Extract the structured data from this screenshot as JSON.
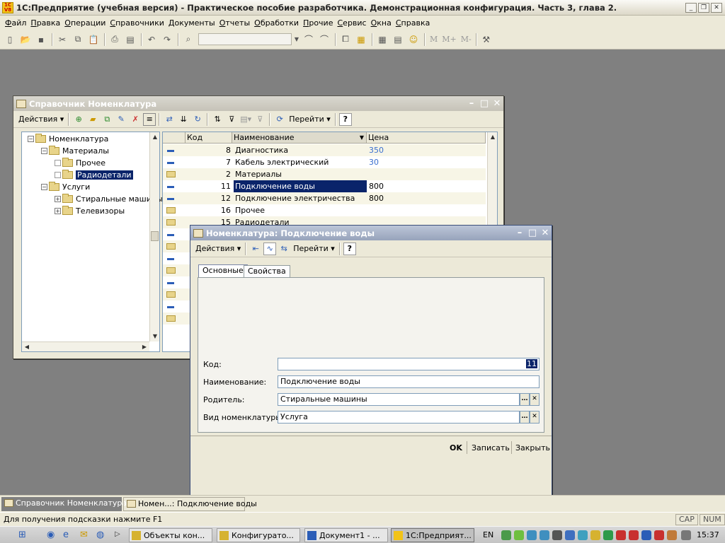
{
  "app": {
    "title": "1С:Предприятие (учебная версия) - Практическое пособие разработчика. Демонстрационная конфигурация. Часть 3, глава 2."
  },
  "menu": [
    {
      "pre": "",
      "u": "Ф",
      "post": "айл"
    },
    {
      "pre": "",
      "u": "П",
      "post": "равка"
    },
    {
      "pre": "",
      "u": "О",
      "post": "перации"
    },
    {
      "pre": "",
      "u": "С",
      "post": "правочники"
    },
    {
      "pre": "",
      "u": "Д",
      "post": "окументы"
    },
    {
      "pre": "",
      "u": "О",
      "post": "тчеты"
    },
    {
      "pre": "",
      "u": "О",
      "post": "бработки"
    },
    {
      "pre": "",
      "u": "П",
      "post": "рочие"
    },
    {
      "pre": "",
      "u": "С",
      "post": "ервис"
    },
    {
      "pre": "",
      "u": "О",
      "post": "кна"
    },
    {
      "pre": "",
      "u": "С",
      "post": "правка"
    }
  ],
  "toolbar_m": [
    "M",
    "M+",
    "M-"
  ],
  "catalog_window": {
    "title": "Справочник Номенклатура",
    "actions_label": "Действия",
    "goto_label": "Перейти",
    "help_label": "?",
    "tree": [
      {
        "label": "Номенклатура",
        "level": 0,
        "box": "-"
      },
      {
        "label": "Материалы",
        "level": 1,
        "box": "-"
      },
      {
        "label": "Прочее",
        "level": 2,
        "box": ""
      },
      {
        "label": "Радиодетали",
        "level": 2,
        "box": "",
        "selected": true
      },
      {
        "label": "Услуги",
        "level": 1,
        "box": "-"
      },
      {
        "label": "Стиральные машины",
        "level": 2,
        "box": "+"
      },
      {
        "label": "Телевизоры",
        "level": 2,
        "box": "+"
      }
    ],
    "columns": [
      "Код",
      "Наименование",
      "Цена"
    ],
    "rows": [
      {
        "icon": "item",
        "code": "8",
        "name": "Диагностика",
        "price": "350",
        "price_blue": true
      },
      {
        "icon": "item",
        "code": "7",
        "name": "Кабель электрический",
        "price": "30",
        "price_blue": true
      },
      {
        "icon": "folder",
        "code": "2",
        "name": "Материалы",
        "price": ""
      },
      {
        "icon": "item",
        "code": "11",
        "name": "Подключение воды",
        "price": "800",
        "selected": true
      },
      {
        "icon": "item",
        "code": "12",
        "name": "Подключение электричества",
        "price": "800"
      },
      {
        "icon": "folder",
        "code": "16",
        "name": "Прочее",
        "price": ""
      },
      {
        "icon": "folder",
        "code": "15",
        "name": "Радиодетали",
        "price": ""
      },
      {
        "icon": "item",
        "code": "",
        "name": "",
        "price": ""
      },
      {
        "icon": "folder",
        "code": "",
        "name": "",
        "price": ""
      },
      {
        "icon": "item",
        "code": "",
        "name": "",
        "price": ""
      },
      {
        "icon": "folder",
        "code": "",
        "name": "",
        "price": ""
      },
      {
        "icon": "item",
        "code": "",
        "name": "",
        "price": ""
      },
      {
        "icon": "folder",
        "code": "",
        "name": "",
        "price": ""
      },
      {
        "icon": "item",
        "code": "",
        "name": "",
        "price": ""
      },
      {
        "icon": "folder",
        "code": "",
        "name": "",
        "price": ""
      }
    ]
  },
  "dialog": {
    "title": "Номенклатура: Подключение воды",
    "actions_label": "Действия",
    "goto_label": "Перейти",
    "help_label": "?",
    "tabs": [
      "Основные",
      "Свойства"
    ],
    "fields": {
      "code_label": "Код:",
      "code_value": "11",
      "name_label": "Наименование:",
      "name_value": "Подключение воды",
      "parent_label": "Родитель:",
      "parent_value": "Стиральные машины",
      "kind_label": "Вид номенклатуры:",
      "kind_value": "Услуга"
    },
    "buttons": {
      "ok": "OK",
      "save": "Записать",
      "close": "Закрыть"
    }
  },
  "window_tabs": [
    "Справочник Номенклатура",
    "Номен...: Подключение воды"
  ],
  "status": {
    "hint": "Для получения подсказки нажмите F1",
    "cap": "CAP",
    "num": "NUM"
  },
  "taskbar": {
    "tasks": [
      "Объекты кон...",
      "Конфигурато...",
      "Документ1 - ...",
      "1С:Предприят..."
    ],
    "lang": "EN",
    "clock": "15:37"
  },
  "colors": {
    "selection": "#0a246a",
    "price_link": "#3a6fcf",
    "workspace": "#808080"
  }
}
